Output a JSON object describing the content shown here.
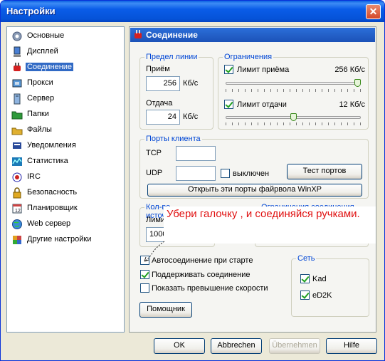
{
  "window": {
    "title": "Настройки",
    "close_symbol": "✕"
  },
  "sidebar": {
    "items": [
      {
        "label": "Основные",
        "icon": "gear-icon"
      },
      {
        "label": "Дисплей",
        "icon": "monitor-icon"
      },
      {
        "label": "Соединение",
        "icon": "plug-icon",
        "selected": true
      },
      {
        "label": "Прокси",
        "icon": "proxy-icon"
      },
      {
        "label": "Сервер",
        "icon": "server-icon"
      },
      {
        "label": "Папки",
        "icon": "folder-icon"
      },
      {
        "label": "Файлы",
        "icon": "files-icon"
      },
      {
        "label": "Уведомления",
        "icon": "notification-icon"
      },
      {
        "label": "Статистика",
        "icon": "statistics-icon"
      },
      {
        "label": "IRC",
        "icon": "irc-icon"
      },
      {
        "label": "Безопасность",
        "icon": "lock-icon"
      },
      {
        "label": "Планировщик",
        "icon": "calendar-icon"
      },
      {
        "label": "Web сервер",
        "icon": "globe-icon"
      },
      {
        "label": "Другие настройки",
        "icon": "puzzle-icon"
      }
    ]
  },
  "panel": {
    "title": "Соединение",
    "line_limit": {
      "label": "Предел линии",
      "download_label": "Приём",
      "download_value": "256",
      "download_unit": "Кб/с",
      "upload_label": "Отдача",
      "upload_value": "24",
      "upload_unit": "Кб/с"
    },
    "limits": {
      "label": "Ограничения",
      "download_limit_label": "Лимит приёма",
      "download_limit_value": "256 Кб/с",
      "download_checked": true,
      "download_slider_fraction": 1.0,
      "upload_limit_label": "Лимит отдачи",
      "upload_limit_value": "12 Кб/с",
      "upload_checked": true,
      "upload_slider_fraction": 0.5
    },
    "ports": {
      "label": "Порты клиента",
      "tcp_label": "TCP",
      "tcp_value": "",
      "udp_label": "UDP",
      "udp_value": "",
      "udp_disabled_label": "выключен",
      "udp_disabled_checked": false,
      "test_button": "Тест портов",
      "open_firewall_button": "Открыть эти порты файрвола WinXP"
    },
    "sources": {
      "label": "Кол-во источников",
      "limit_label": "Лими",
      "limit_value": "1000"
    },
    "connections_label": "Ограничения соединения",
    "options": {
      "autoconnect": {
        "label": "Автосоединение при старте",
        "checked": false
      },
      "keep_connection": {
        "label": "Поддерживать соединение",
        "checked": true
      },
      "show_overhead": {
        "label": "Показать превышение скорости",
        "checked": false
      }
    },
    "wizard_button": "Помощник",
    "network": {
      "label": "Сеть",
      "kad_label": "Kad",
      "kad_checked": true,
      "ed2k_label": "eD2K",
      "ed2k_checked": true
    }
  },
  "annotation": {
    "text": "Убери галочку , и соединяйся ручками.",
    "color": "#e01010"
  },
  "footer": {
    "ok": "OK",
    "cancel": "Abbrechen",
    "apply": "Übernehmen",
    "help": "Hilfe"
  }
}
